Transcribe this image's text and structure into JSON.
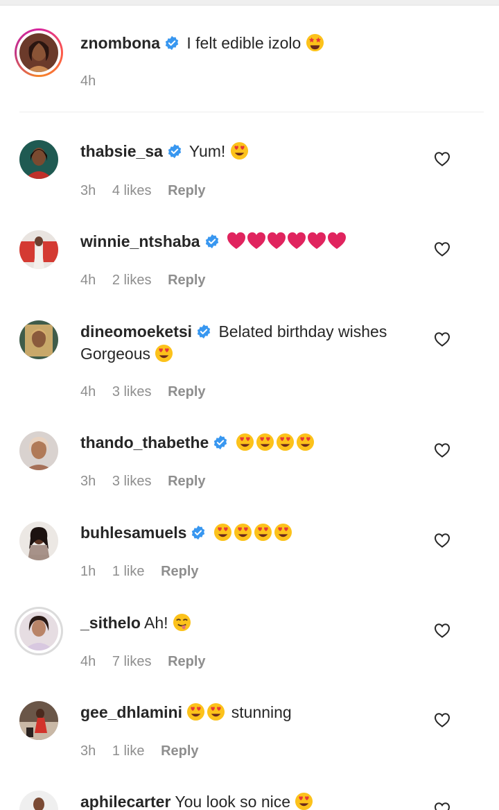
{
  "colors": {
    "text": "#262626",
    "muted": "#8e8e8e",
    "verified": "#3897f0",
    "heart": "#e0245e",
    "divider": "#ececec"
  },
  "caption": {
    "username": "znombona",
    "verified": true,
    "text": "I felt edible izolo",
    "emoji": "star-struck-emoji",
    "time": "4h"
  },
  "comments": [
    {
      "username": "thabsie_sa",
      "verified": true,
      "text": "Yum!",
      "emojis": [
        "heart-eyes-emoji"
      ],
      "time": "3h",
      "likes": "4 likes",
      "reply": "Reply"
    },
    {
      "username": "winnie_ntshaba",
      "verified": true,
      "text": "",
      "emojis": [
        "red-heart-emoji",
        "red-heart-emoji",
        "red-heart-emoji",
        "red-heart-emoji",
        "red-heart-emoji",
        "red-heart-emoji"
      ],
      "time": "4h",
      "likes": "2 likes",
      "reply": "Reply"
    },
    {
      "username": "dineomoeketsi",
      "verified": true,
      "text": "Belated birthday wishes Gorgeous",
      "emojis": [
        "heart-eyes-emoji"
      ],
      "time": "4h",
      "likes": "3 likes",
      "reply": "Reply"
    },
    {
      "username": "thando_thabethe",
      "verified": true,
      "text": "",
      "emojis": [
        "heart-eyes-emoji",
        "heart-eyes-emoji",
        "heart-eyes-emoji",
        "heart-eyes-emoji"
      ],
      "time": "3h",
      "likes": "3 likes",
      "reply": "Reply"
    },
    {
      "username": "buhlesamuels",
      "verified": true,
      "text": "",
      "emojis": [
        "heart-eyes-emoji",
        "heart-eyes-emoji",
        "heart-eyes-emoji",
        "heart-eyes-emoji"
      ],
      "time": "1h",
      "likes": "1 like",
      "reply": "Reply"
    },
    {
      "username": "_sithelo",
      "verified": false,
      "text": "Ah!",
      "emojis": [
        "winking-tongue-emoji"
      ],
      "time": "4h",
      "likes": "7 likes",
      "reply": "Reply"
    },
    {
      "username": "gee_dhlamini",
      "verified": false,
      "text": "stunning",
      "emojis": [
        "heart-eyes-emoji",
        "heart-eyes-emoji"
      ],
      "time": "3h",
      "likes": "1 like",
      "reply": "Reply"
    },
    {
      "username": "aphilecarter",
      "verified": false,
      "text": "You look so nice",
      "emojis": [
        "heart-eyes-emoji"
      ],
      "time": "",
      "likes": "",
      "reply": ""
    }
  ]
}
